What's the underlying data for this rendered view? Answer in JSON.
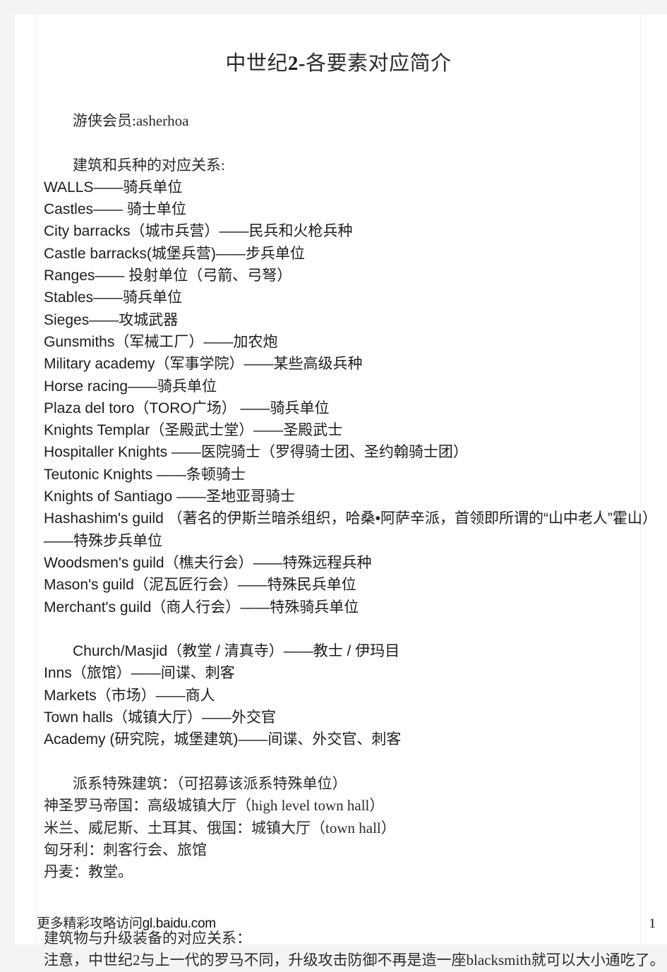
{
  "document": {
    "title_prefix": "中世纪",
    "title_bold": "2-",
    "title_suffix": "各要素对应简介",
    "title_full": "中世纪2-各要素对应简介",
    "member_line": "游侠会员:asherhoa",
    "page_number": "1"
  },
  "section_buildings_units": {
    "heading": "建筑和兵种的对应关系:",
    "lines": [
      "WALLS——骑兵单位",
      "Castles—— 骑士单位",
      "City barracks（城市兵营）——民兵和火枪兵种",
      "Castle barracks(城堡兵营)——步兵单位",
      "Ranges—— 投射单位（弓箭、弓弩）",
      "Stables——骑兵单位",
      "Sieges——攻城武器",
      "Gunsmiths（军械工厂）——加农炮",
      "Military academy（军事学院）——某些高级兵种",
      "Horse racing——骑兵单位",
      "Plaza del toro（TORO广场） ——骑兵单位",
      "Knights Templar（圣殿武士堂）——圣殿武士",
      "Hospitaller Knights ——医院骑士（罗得骑士团、圣约翰骑士团）",
      "Teutonic Knights ——条顿骑士",
      "Knights of Santiago ——圣地亚哥骑士",
      "Hashashim's guild （著名的伊斯兰暗杀组织，哈桑•阿萨辛派，首领即所谓的“山中老人”霍山）——特殊步兵单位",
      "Woodsmen's guild（樵夫行会）——特殊远程兵种",
      "Mason's guild（泥瓦匠行会）——特殊民兵单位",
      "Merchant's guild（商人行会）——特殊骑兵单位"
    ]
  },
  "section_civil_buildings": {
    "lines": [
      "Church/Masjid（教堂 / 清真寺）——教士 / 伊玛目",
      "Inns（旅馆）——间谍、刺客",
      "Markets（市场）——商人",
      "Town halls（城镇大厅）——外交官",
      "Academy (研究院，城堡建筑)——间谍、外交官、刺客"
    ]
  },
  "section_faction_buildings": {
    "heading": "派系特殊建筑：（可招募该派系特殊单位）",
    "lines": [
      "神圣罗马帝国：高级城镇大厅（high level town hall）",
      "米兰、威尼斯、土耳其、俄国：城镇大厅（town hall）",
      "匈牙利：刺客行会、旅馆",
      "丹麦：教堂。"
    ]
  },
  "section_upgrades": {
    "heading": "建筑物与升级装备的对应关系：",
    "note": "注意，中世纪2与上一代的罗马不同，升级攻击防御不再是造一座blacksmith就可以大小通吃了。"
  },
  "footer": {
    "note_cjk": "更多精彩攻略访问",
    "note_url": "gl.baidu.com",
    "note_full": "更多精彩攻略访问gl.baidu.com",
    "page_number": "1"
  },
  "colors": {
    "page_background": "#ffffff",
    "canvas_background": "#f4f4f4",
    "latin_text": "#1d1d1d",
    "cjk_text": "#2b2b2b",
    "margin_guide": "#f2f2f2"
  }
}
